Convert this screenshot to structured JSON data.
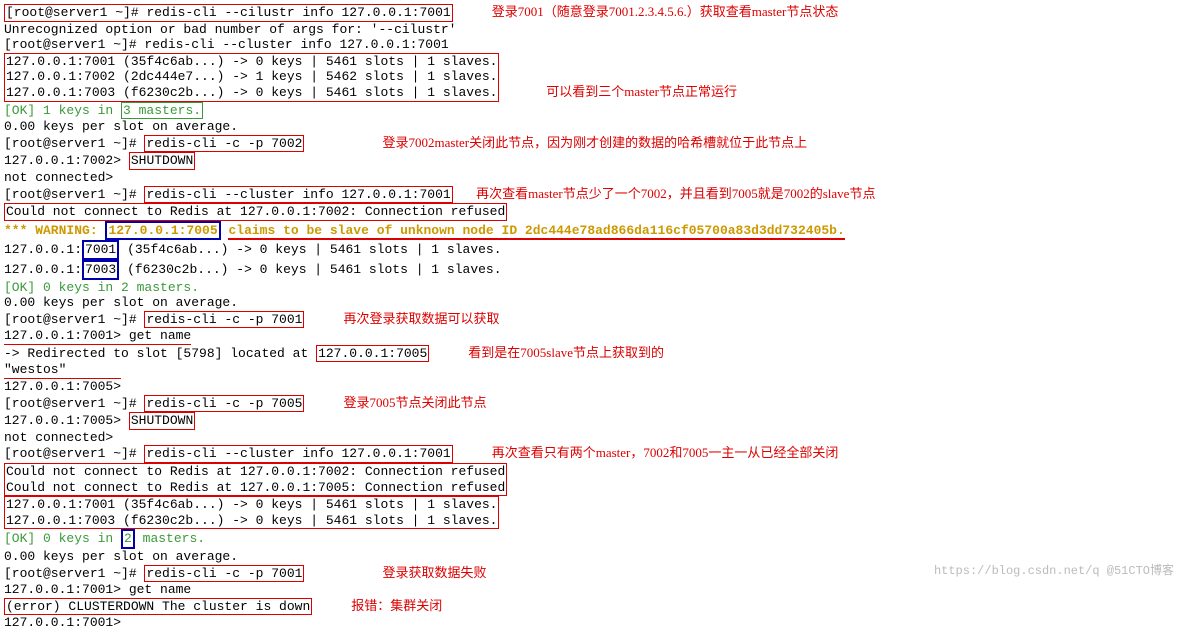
{
  "lines": {
    "l1_prompt": "[root@server1 ~]#",
    "l1_cmd": "redis-cli --cilustr info 127.0.0.1:7001",
    "l1_anno": "登录7001（随意登录7001.2.3.4.5.6.）获取查看master节点状态",
    "l2": "Unrecognized option or bad number of args for: '--cilustr'",
    "l3": "[root@server1 ~]# redis-cli --cluster info 127.0.0.1:7001",
    "l4": "127.0.0.1:7001 (35f4c6ab...) -> 0 keys | 5461 slots | 1 slaves.",
    "l5": "127.0.0.1:7002 (2dc444e7...) -> 1 keys | 5462 slots | 1 slaves.",
    "l6": "127.0.0.1:7003 (f6230c2b...) -> 0 keys | 5461 slots | 1 slaves.",
    "l456_anno": "可以看到三个master节点正常运行",
    "l7a": "[OK] 1 keys in",
    "l7b": "3 masters.",
    "l8": "0.00 keys per slot on average.",
    "l9_prompt": "[root@server1 ~]#",
    "l9_cmd": "redis-cli -c -p 7002",
    "l9_anno": "登录7002master关闭此节点，因为刚才创建的数据的哈希槽就位于此节点上",
    "l10a": "127.0.0.1:7002>",
    "l10b": "SHUTDOWN",
    "l11": "not connected>",
    "l12_prompt": "[root@server1 ~]#",
    "l12_cmd": "redis-cli --cluster info 127.0.0.1:7001",
    "l12_anno": "再次查看master节点少了一个7002，并且看到7005就是7002的slave节点",
    "l13a": "Could not connect to Redis at 127.0.0.1:7002: Connection refused",
    "l14_warn_a": "*** WARNING:",
    "l14_warn_ip": "127.0.0.1:7005",
    "l14_warn_b": "claims to be slave of unknown node ID 2dc444e78ad866da116cf05700a83d3dd732405b.",
    "l15a": "127.0.0.1",
    "l15b": "7001",
    "l15c": "(35f4c6ab...) -> 0 keys | 5461 slots | 1 slaves.",
    "l16a": "127.0.0.1",
    "l16b": "7003",
    "l16c": "(f6230c2b...) -> 0 keys | 5461 slots | 1 slaves.",
    "l17": "[OK] 0 keys in 2 masters.",
    "l18": "0.00 keys per slot on average.",
    "l19_prompt": "[root@server1 ~]#",
    "l19_cmd": "redis-cli -c -p 7001",
    "l19_anno": "再次登录获取数据可以获取",
    "l20": "127.0.0.1:7001> get name",
    "l21a": "-> Redirected to slot [5798] located at",
    "l21b": "127.0.0.1:7005",
    "l21_anno": "看到是在7005slave节点上获取到的",
    "l22": "\"westos\"",
    "l23": "127.0.0.1:7005>",
    "l24_prompt": "[root@server1 ~]#",
    "l24_cmd": "redis-cli -c -p 7005",
    "l24_anno": "登录7005节点关闭此节点",
    "l25a": "127.0.0.1:7005>",
    "l25b": "SHUTDOWN",
    "l26": "not connected>",
    "l27_prompt": "[root@server1 ~]#",
    "l27_cmd": "redis-cli --cluster info 127.0.0.1:7001",
    "l27_anno": "再次查看只有两个master，7002和7005一主一从已经全部关闭",
    "l28a": "Could not connect to Redis at 127.0.0.1:7002: Connection refused",
    "l28b": "Could not connect to Redis at 127.0.0.1:7005: Connection refused",
    "l29": "127.0.0.1:7001 (35f4c6ab...) -> 0 keys | 5461 slots | 1 slaves.",
    "l30": "127.0.0.1:7003 (f6230c2b...) -> 0 keys | 5461 slots | 1 slaves.",
    "l31a": "[OK] 0 keys in",
    "l31b": "2",
    "l31c": "masters.",
    "l32": "0.00 keys per slot on average.",
    "l33_prompt": "[root@server1 ~]#",
    "l33_cmd": "redis-cli -c -p 7001",
    "l33_anno": "登录获取数据失败",
    "l34": "127.0.0.1:7001> get name",
    "l35": "(error) CLUSTERDOWN The cluster is down",
    "l35_anno": "报错：集群关闭",
    "l36": "127.0.0.1:7001>"
  },
  "watermark": "https://blog.csdn.net/q @51CTO博客"
}
